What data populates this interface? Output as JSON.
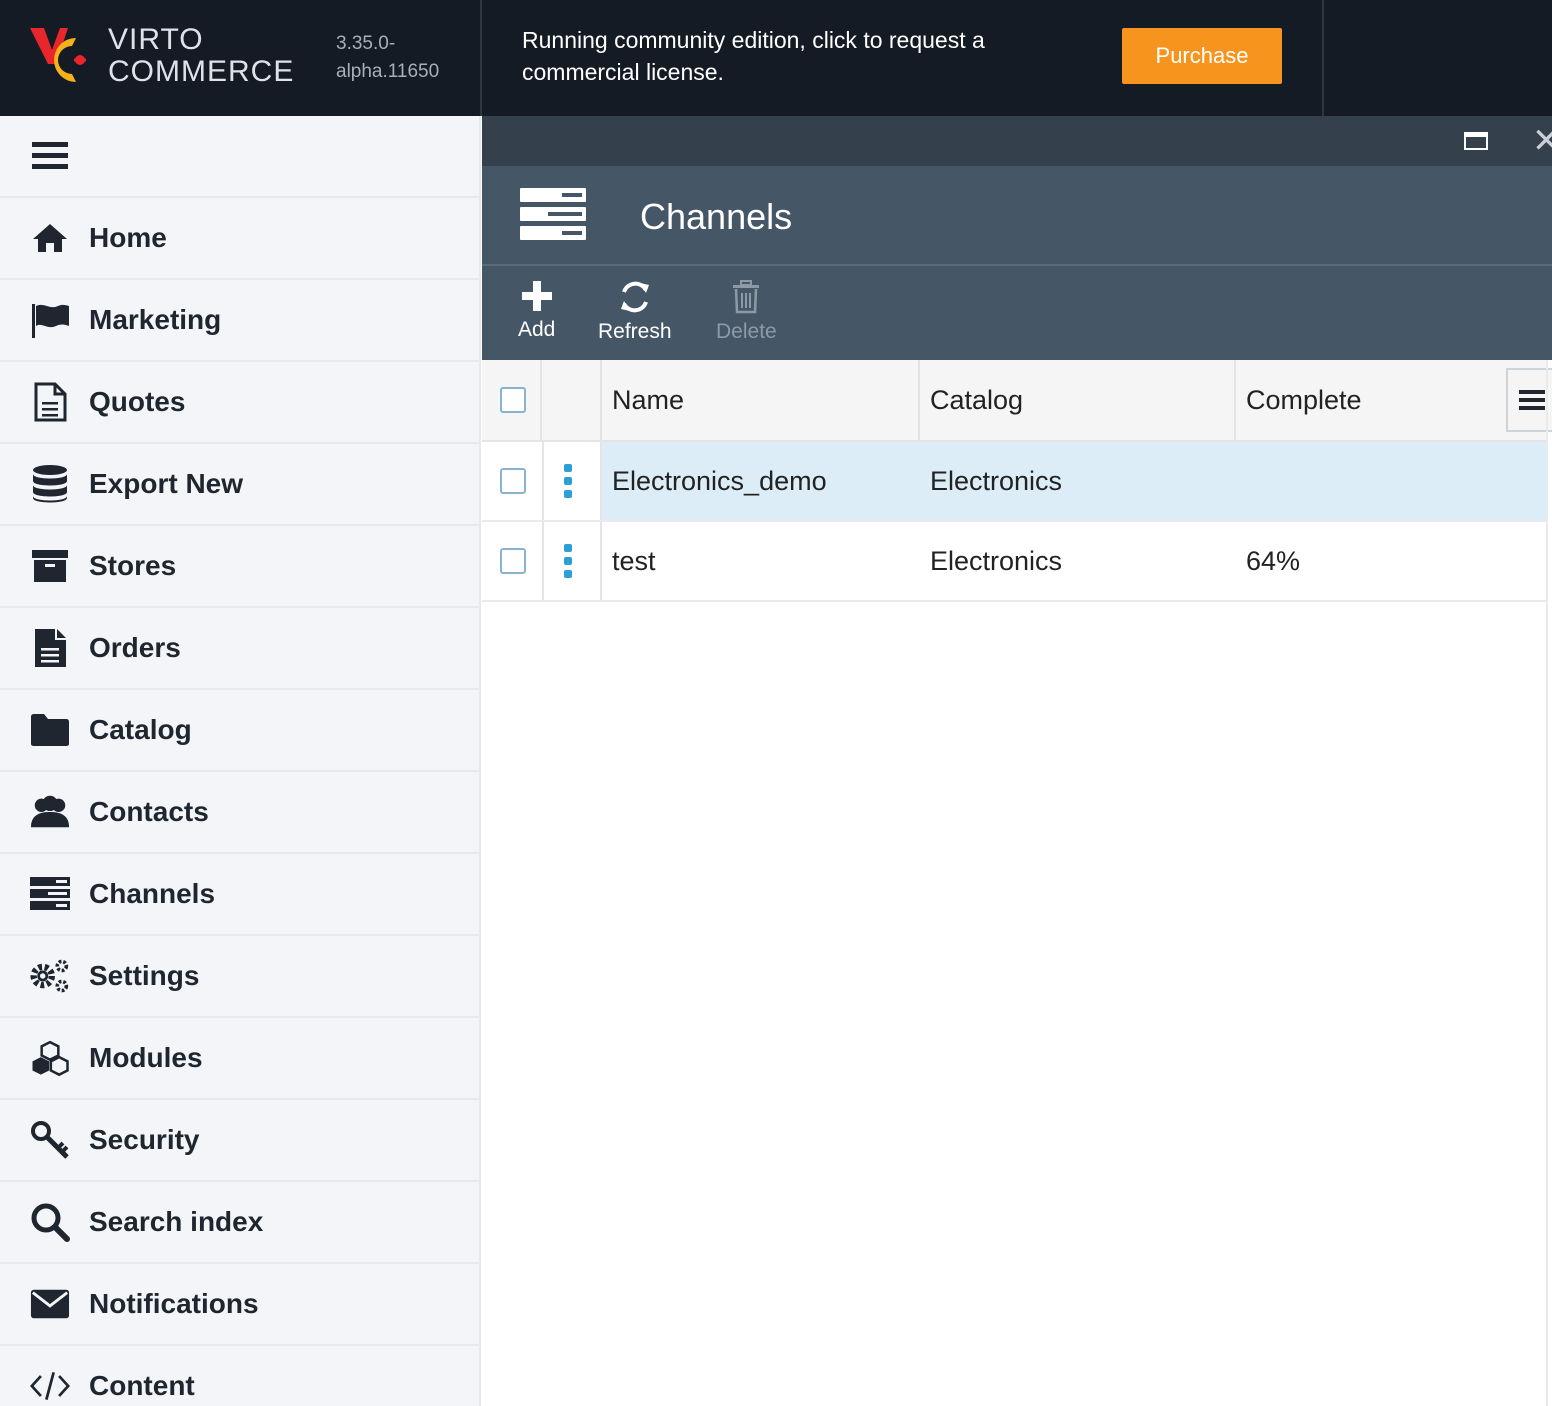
{
  "header": {
    "logo_line1": "VIRTO",
    "logo_line2": "COMMERCE",
    "version_line1": "3.35.0-",
    "version_line2": "alpha.11650",
    "license_text": "Running community edition, click to request a commercial license.",
    "purchase_label": "Purchase"
  },
  "sidebar": {
    "items": [
      {
        "label": "Home",
        "icon": "home-icon"
      },
      {
        "label": "Marketing",
        "icon": "flag-icon"
      },
      {
        "label": "Quotes",
        "icon": "document-icon"
      },
      {
        "label": "Export New",
        "icon": "database-icon"
      },
      {
        "label": "Stores",
        "icon": "archive-icon"
      },
      {
        "label": "Orders",
        "icon": "file-text-icon"
      },
      {
        "label": "Catalog",
        "icon": "folder-icon"
      },
      {
        "label": "Contacts",
        "icon": "users-icon"
      },
      {
        "label": "Channels",
        "icon": "server-icon"
      },
      {
        "label": "Settings",
        "icon": "gears-icon"
      },
      {
        "label": "Modules",
        "icon": "cubes-icon"
      },
      {
        "label": "Security",
        "icon": "key-icon"
      },
      {
        "label": "Search index",
        "icon": "search-icon"
      },
      {
        "label": "Notifications",
        "icon": "envelope-icon"
      },
      {
        "label": "Content",
        "icon": "code-icon"
      }
    ]
  },
  "blade": {
    "title": "Channels",
    "toolbar": {
      "add": "Add",
      "refresh": "Refresh",
      "delete": "Delete"
    },
    "columns": {
      "name": "Name",
      "catalog": "Catalog",
      "complete": "Complete"
    },
    "rows": [
      {
        "name": "Electronics_demo",
        "catalog": "Electronics",
        "complete": "",
        "selected": true
      },
      {
        "name": "test",
        "catalog": "Electronics",
        "complete": "64%",
        "selected": false
      }
    ]
  },
  "colors": {
    "topbar": "#151b24",
    "accent_orange": "#f7941d",
    "blade_header": "#455767",
    "selected_row": "#dcedf8"
  }
}
